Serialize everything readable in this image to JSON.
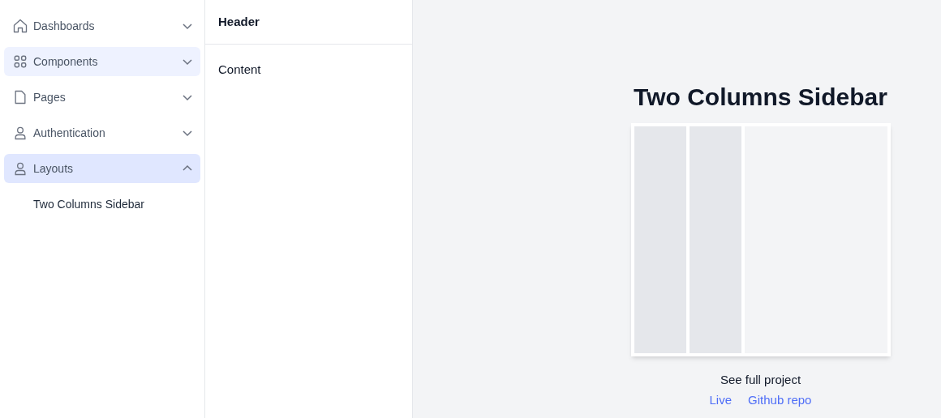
{
  "sidebar": {
    "items": [
      {
        "label": "Dashboards",
        "selected": false,
        "hovered": false,
        "expanded": false
      },
      {
        "label": "Components",
        "selected": false,
        "hovered": true,
        "expanded": false
      },
      {
        "label": "Pages",
        "selected": false,
        "hovered": false,
        "expanded": false
      },
      {
        "label": "Authentication",
        "selected": false,
        "hovered": false,
        "expanded": false
      },
      {
        "label": "Layouts",
        "selected": true,
        "hovered": false,
        "expanded": true,
        "children": [
          {
            "label": "Two Columns Sidebar"
          }
        ]
      }
    ]
  },
  "panel": {
    "header": "Header",
    "content": "Content"
  },
  "preview": {
    "title": "Two Columns Sidebar",
    "caption": "See full project",
    "links": [
      "Live",
      "Github repo"
    ]
  }
}
